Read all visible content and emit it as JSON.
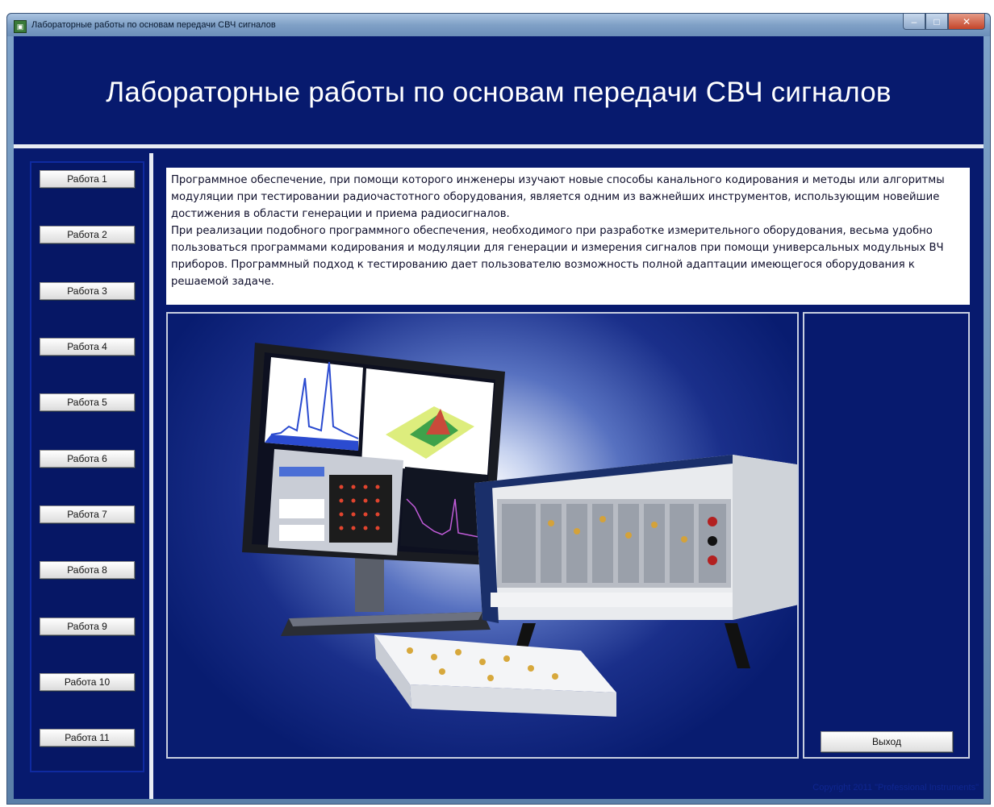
{
  "window": {
    "title": "Лабораторные работы по основам передачи СВЧ сигналов",
    "buttons": {
      "minimize": "–",
      "maximize": "□",
      "close": "✕"
    }
  },
  "header": {
    "title": "Лабораторные работы по основам передачи СВЧ сигналов"
  },
  "sidebar": {
    "items": [
      {
        "label": "Работа 1"
      },
      {
        "label": "Работа 2"
      },
      {
        "label": "Работа 3"
      },
      {
        "label": "Работа 4"
      },
      {
        "label": "Работа 5"
      },
      {
        "label": "Работа 6"
      },
      {
        "label": "Работа 7"
      },
      {
        "label": "Работа 8"
      },
      {
        "label": "Работа 9"
      },
      {
        "label": "Работа 10"
      },
      {
        "label": "Работа 11"
      }
    ]
  },
  "description": {
    "paragraph1": "Программное обеспечение, при помощи которого инженеры изучают новые способы канального кодирования и методы или алгоритмы модуляции при тестировании радиочастотного оборудования, является одним из важнейших инструментов, использующим новейшие достижения в области генерации и приема радиосигналов.",
    "paragraph2": "При реализации подобного программного обеспечения, необходимого при разработке измерительного оборудования, весьма удобно пользоваться программами кодирования и модуляции для генерации и измерения сигналов при помощи универсальных модульных ВЧ приборов. Программный подход к тестированию дает пользователю возможность полной адаптации имеющегося оборудования к решаемой задаче."
  },
  "exit_button": {
    "label": "Выход"
  },
  "footer": {
    "copyright": "Copyright 2011 \"Professional Instruments\""
  },
  "colors": {
    "background": "#071a6e",
    "separator": "#e8ecf4",
    "button_face": "#f2f2f2"
  },
  "icons": {
    "app": "app-icon",
    "illustration": "monitor-and-pxi-chassis-illustration"
  }
}
